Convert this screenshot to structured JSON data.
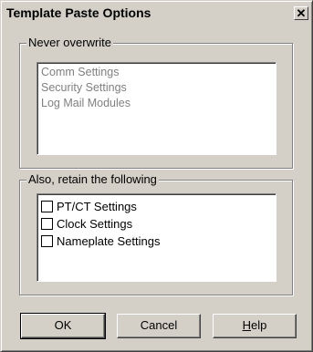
{
  "window": {
    "title": "Template Paste Options",
    "close_glyph": "✕"
  },
  "never_overwrite": {
    "label": "Never overwrite",
    "items": [
      "Comm Settings",
      "Security Settings",
      "Log Mail Modules"
    ]
  },
  "retain": {
    "label": "Also, retain the following",
    "options": [
      {
        "label": "PT/CT Settings",
        "checked": false
      },
      {
        "label": "Clock Settings",
        "checked": false
      },
      {
        "label": "Nameplate Settings",
        "checked": false
      }
    ]
  },
  "buttons": {
    "ok": "OK",
    "cancel": "Cancel",
    "help_first": "H",
    "help_rest": "elp"
  },
  "icons": {
    "close": "close-icon"
  }
}
